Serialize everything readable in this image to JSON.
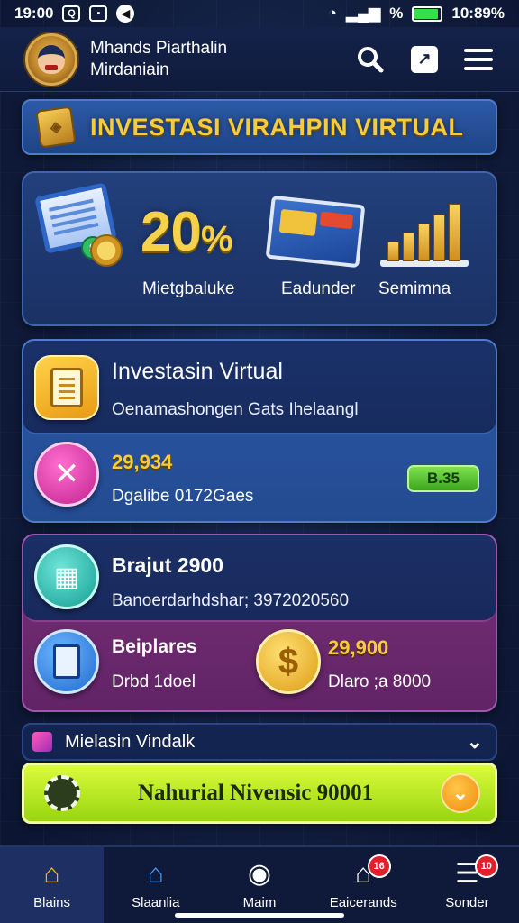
{
  "status_bar": {
    "time": "19:00",
    "battery_text": "%",
    "clock_right": "10:89%"
  },
  "header": {
    "app_title_line1": "Mhands Piarthalin",
    "app_title_line2": "Mirdaniain"
  },
  "banner": {
    "title": "INVESTASI VIRAHPIN VIRTUAL"
  },
  "stats": {
    "percent": "20",
    "percent_sign": "%",
    "label_1": "Mietgbaluke",
    "label_2": "Eadunder",
    "label_3": "Semimna",
    "card_text": "NOTE",
    "chart_bars": [
      0.35,
      0.5,
      0.65,
      0.82,
      1.0
    ]
  },
  "investment_card": {
    "title": "Investasin Virtual",
    "subtitle": "Oenamashongen Gats Ihelaangl",
    "amount": "29,934",
    "detail": "Dgalibe 0172Gaes",
    "pill": "B.35"
  },
  "purple_card": {
    "title": "Brajut 2900",
    "subtitle": "Banoerdarhdshar; 3972020560",
    "item_title": "Beiplares",
    "item_sub": "Drbd 1doel",
    "amount": "29,900",
    "amount_sub": "Dlaro ;a 8000"
  },
  "link_row": {
    "label": "Mielasin Vindalk"
  },
  "cta": {
    "label": "Nahurial Nivensic 90001"
  },
  "bottom_nav": {
    "items": [
      {
        "label": "Blains",
        "icon": "home-icon",
        "active": true
      },
      {
        "label": "Slaanlia",
        "icon": "house-icon"
      },
      {
        "label": "Maim",
        "icon": "search-icon"
      },
      {
        "label": "Eaicerands",
        "icon": "portfolio-icon",
        "badge": "16"
      },
      {
        "label": "Sonder",
        "icon": "menu-icon",
        "badge": "10"
      }
    ]
  },
  "colors": {
    "accent_gold": "#f5d24a",
    "cta_green": "#c8f02e",
    "badge_red": "#e3202a"
  }
}
